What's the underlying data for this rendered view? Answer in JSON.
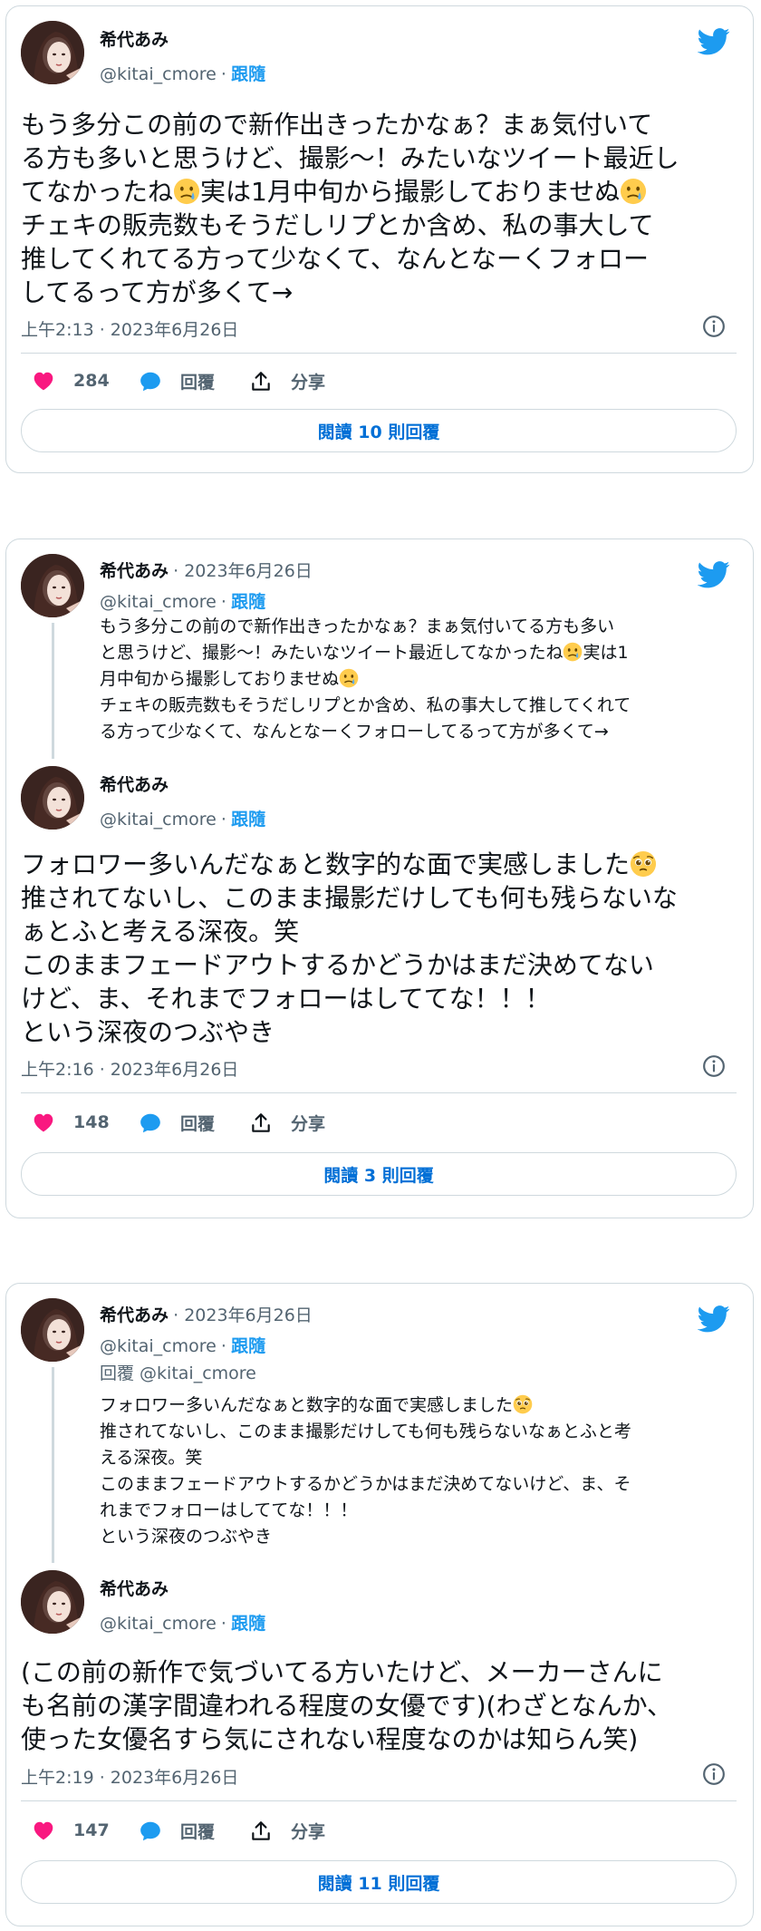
{
  "brand": {
    "twitter_blue": "#1d9bf0",
    "like_red": "#f91880",
    "text_primary": "#0f1419",
    "text_secondary": "#536471",
    "border": "#cfd9de"
  },
  "author": {
    "name": "希代あみ",
    "handle": "@kitai_cmore",
    "follow_label": "跟隨",
    "separator": "·"
  },
  "tweet1": {
    "text_lines": [
      "もう多分この前ので新作出きったかなぁ？まぁ気付いて",
      "る方も多いと思うけど、撮影〜！みたいなツイート最近し",
      "てなかったね",
      "実は1月中旬から撮影しておりませぬ",
      "チェキの販売数もそうだしリプとか含め、私の事大して",
      "推してくれてる方って少なくて、なんとなーくフォロー",
      "してるって方が多くて→"
    ],
    "timestamp": "上午2:13 · 2023年6月26日",
    "likes": "284",
    "reply_label": "回覆",
    "share_label": "分享",
    "read_replies": "閱讀 10 則回覆"
  },
  "tweet2": {
    "quoted": {
      "date": "· 2023年6月26日",
      "text_lines": [
        "もう多分この前ので新作出きったかなぁ？まぁ気付いてる方も多い",
        "と思うけど、撮影〜！みたいなツイート最近してなかったね",
        "実は1",
        "月中旬から撮影しておりませぬ",
        "チェキの販売数もそうだしリプとか含め、私の事大して推してくれて",
        "る方って少なくて、なんとなーくフォローしてるって方が多くて→"
      ]
    },
    "text_lines": [
      "フォロワー多いんだなぁと数字的な面で実感しました",
      "推されてないし、このまま撮影だけしても何も残らないな",
      "ぁとふと考える深夜。笑",
      "このままフェードアウトするかどうかはまだ決めてない",
      "けど、ま、それまでフォローはしててな！！！",
      "という深夜のつぶやき"
    ],
    "timestamp": "上午2:16 · 2023年6月26日",
    "likes": "148",
    "reply_label": "回覆",
    "share_label": "分享",
    "read_replies": "閱讀 3 則回覆"
  },
  "tweet3": {
    "quoted": {
      "date": "· 2023年6月26日",
      "reply_to": "回覆 @kitai_cmore",
      "text_lines": [
        "フォロワー多いんだなぁと数字的な面で実感しました",
        "推されてないし、このまま撮影だけしても何も残らないなぁとふと考",
        "える深夜。笑",
        "このままフェードアウトするかどうかはまだ決めてないけど、ま、そ",
        "れまでフォローはしててな！！！",
        "という深夜のつぶやき"
      ]
    },
    "text_lines": [
      "(この前の新作で気づいてる方いたけど、メーカーさんに",
      "も名前の漢字間違われる程度の女優です)(わざとなんか、",
      "使った女優名すら気にされない程度なのかは知らん笑)"
    ],
    "timestamp": "上午2:19 · 2023年6月26日",
    "likes": "147",
    "reply_label": "回覆",
    "share_label": "分享",
    "read_replies": "閱讀 11 則回覆"
  },
  "icons": {
    "bird": "twitter-bird-icon",
    "info": "info-icon",
    "heart": "heart-icon",
    "reply": "reply-bubble-icon",
    "share": "share-icon",
    "emoji_tear": "crying-face-emoji",
    "emoji_pleading": "pleading-face-emoji"
  }
}
